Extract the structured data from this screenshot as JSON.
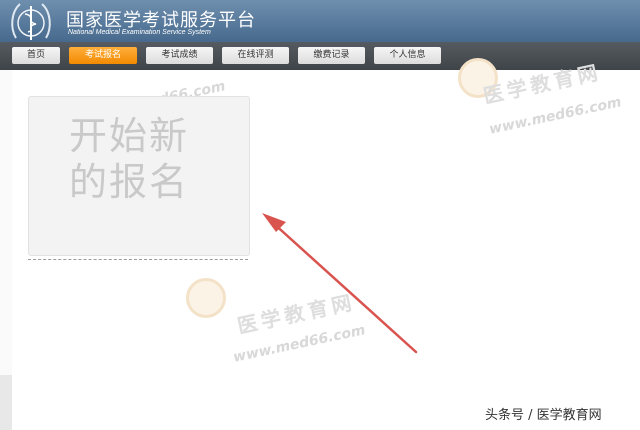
{
  "header": {
    "title_cn": "国家医学考试服务平台",
    "title_en": "National Medical Examination Service System"
  },
  "nav": {
    "tabs": [
      {
        "label": "首页",
        "active": false
      },
      {
        "label": "考试报名",
        "active": true
      },
      {
        "label": "考试成绩",
        "active": false
      },
      {
        "label": "在线评测",
        "active": false
      },
      {
        "label": "缴费记录",
        "active": false
      },
      {
        "label": "个人信息",
        "active": false
      }
    ]
  },
  "main": {
    "new_registration_line1": "开始新",
    "new_registration_line2": "的报名"
  },
  "watermark": {
    "site": "www.med66.com",
    "name_cn": "医学教育网"
  },
  "footer": {
    "credit": "头条号 / 医学教育网"
  },
  "colors": {
    "header": "#5a7b9c",
    "nav": "#4a4f54",
    "active_tab": "#f5900d",
    "arrow": "#d9534f"
  }
}
